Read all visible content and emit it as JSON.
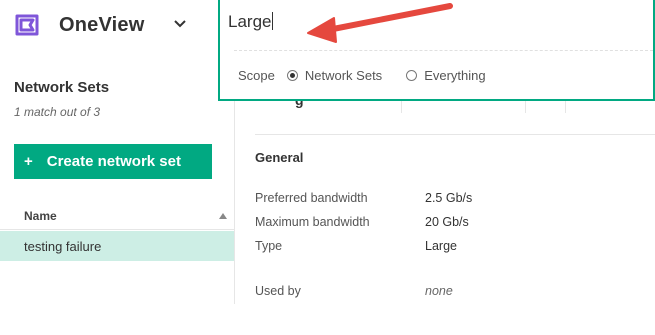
{
  "app": {
    "title": "OneView",
    "brand_color": "#7f56d9"
  },
  "search": {
    "value": "Large",
    "scope_label": "Scope",
    "scope_options": [
      {
        "label": "Network Sets",
        "checked": true
      },
      {
        "label": "Everything",
        "checked": false
      }
    ],
    "border_color": "#01a982"
  },
  "annotation": {
    "arrow_color": "#e5483e"
  },
  "sidebar": {
    "title": "Network Sets",
    "match_count": "1 match out of 3",
    "create_button": {
      "label": "Create network set",
      "icon": "plus-icon",
      "color": "#01a982"
    },
    "column_header": "Name",
    "rows": [
      {
        "name": "testing failure",
        "selected": true
      }
    ]
  },
  "main": {
    "peek_text": "g",
    "section_title": "General",
    "properties": [
      {
        "label": "Preferred bandwidth",
        "value": "2.5 Gb/s"
      },
      {
        "label": "Maximum bandwidth",
        "value": "20 Gb/s"
      },
      {
        "label": "Type",
        "value": "Large"
      },
      {
        "label": "Used by",
        "value": "none"
      }
    ]
  }
}
